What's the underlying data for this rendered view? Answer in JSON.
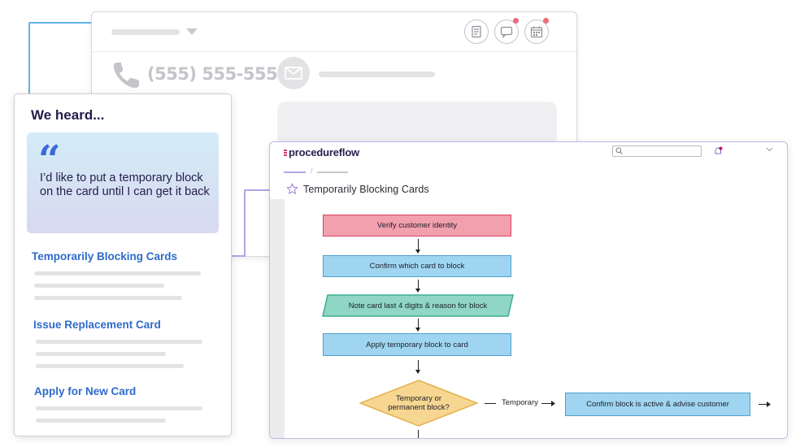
{
  "crm": {
    "phone_number": "(555) 555-5555"
  },
  "heard": {
    "title": "We heard...",
    "quote_mark": "“",
    "quote": "I’d like to put a temporary block on the card until I can get it back",
    "links": [
      "Temporarily Blocking Cards",
      "Issue Replacement Card",
      "Apply for New Card"
    ]
  },
  "procedureflow": {
    "logo": "procedureflow",
    "search_placeholder": "",
    "breadcrumb_separator": "/",
    "title": "Temporarily Blocking Cards",
    "flow": {
      "steps": [
        "Verify customer identity",
        "Confirm which card to block",
        "Note card last 4 digits & reason for block",
        "Apply temporary block to card"
      ],
      "decision": "Temporary or permanent block?",
      "branch_label": "Temporary",
      "branch_step": "Confirm block is active & advise customer"
    }
  },
  "colors": {
    "accent_purple": "#b5a4e4",
    "link_blue": "#2f6bc9",
    "identity_step": "#f29fae",
    "action_step": "#9fd5f0",
    "note_step": "#8fd6c5",
    "decision": "#f6d690",
    "notification_dot": "#f06a7c",
    "connector_blue": "#5fb4e6"
  },
  "icons": {
    "header": [
      "notes-icon",
      "chat-icon",
      "calendar-icon"
    ],
    "crm": [
      "phone-icon",
      "mail-icon"
    ],
    "procedureflow": [
      "search-icon",
      "bell-icon",
      "chevron-down-icon",
      "star-icon"
    ]
  }
}
